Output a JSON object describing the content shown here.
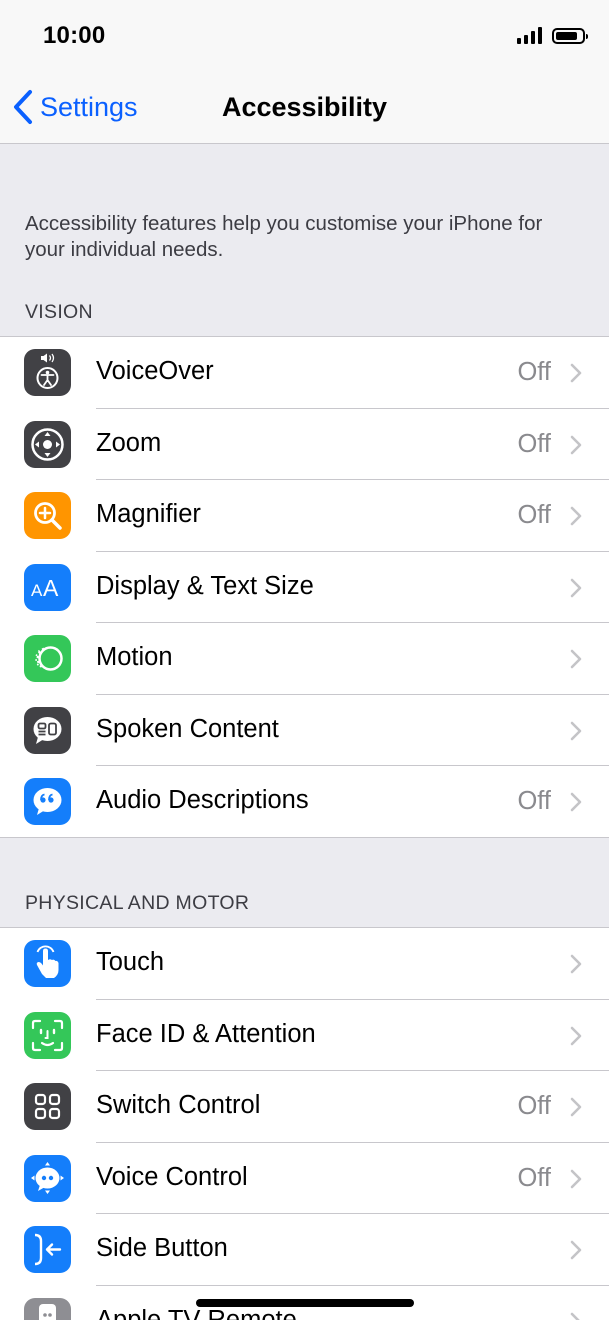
{
  "status_bar": {
    "time": "10:00",
    "signal_icon": "signal-bars-icon",
    "battery_icon": "battery-icon",
    "battery_level": 0.85
  },
  "nav": {
    "back_label": "Settings",
    "title": "Accessibility"
  },
  "description": "Accessibility features help you customise your iPhone for your individual needs.",
  "sections": [
    {
      "header": "VISION",
      "items": [
        {
          "label": "VoiceOver",
          "value": "Off",
          "icon": "voiceover-icon",
          "color": "#414145"
        },
        {
          "label": "Zoom",
          "value": "Off",
          "icon": "zoom-icon",
          "color": "#414145"
        },
        {
          "label": "Magnifier",
          "value": "Off",
          "icon": "magnifier-icon",
          "color": "#ff9500"
        },
        {
          "label": "Display & Text Size",
          "value": "",
          "icon": "display-text-size-icon",
          "color": "#147efb"
        },
        {
          "label": "Motion",
          "value": "",
          "icon": "motion-icon",
          "color": "#34c759"
        },
        {
          "label": "Spoken Content",
          "value": "",
          "icon": "spoken-content-icon",
          "color": "#414145"
        },
        {
          "label": "Audio Descriptions",
          "value": "Off",
          "icon": "audio-descriptions-icon",
          "color": "#147efb"
        }
      ]
    },
    {
      "header": "PHYSICAL AND MOTOR",
      "items": [
        {
          "label": "Touch",
          "value": "",
          "icon": "touch-icon",
          "color": "#147efb"
        },
        {
          "label": "Face ID & Attention",
          "value": "",
          "icon": "face-id-icon",
          "color": "#34c759"
        },
        {
          "label": "Switch Control",
          "value": "Off",
          "icon": "switch-control-icon",
          "color": "#414145"
        },
        {
          "label": "Voice Control",
          "value": "Off",
          "icon": "voice-control-icon",
          "color": "#147efb"
        },
        {
          "label": "Side Button",
          "value": "",
          "icon": "side-button-icon",
          "color": "#147efb"
        },
        {
          "label": "Apple TV Remote",
          "value": "",
          "icon": "apple-tv-remote-icon",
          "color": "#8e8e93"
        }
      ]
    }
  ]
}
